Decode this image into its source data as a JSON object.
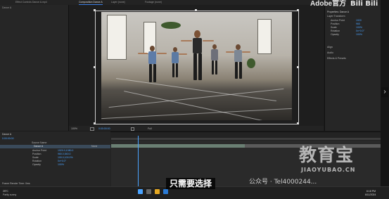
{
  "top_tabs": [
    {
      "label": "Effect Controls Dance A.mp4"
    },
    {
      "label": "Composition Dance A"
    },
    {
      "label": "Layer (none)"
    },
    {
      "label": "Footage (none)"
    }
  ],
  "project_panel": {
    "title": "Dance A"
  },
  "properties_panel": {
    "title": "Properties: Dance A",
    "section": "Layer Transform",
    "rows": [
      {
        "label": "Anchor Point",
        "value": "1920"
      },
      {
        "label": "Position",
        "value": "960"
      },
      {
        "label": "Scale",
        "value": "100%"
      },
      {
        "label": "Rotation",
        "value": "0x+0.0°"
      },
      {
        "label": "Opacity",
        "value": "100%"
      }
    ],
    "groups": [
      "Align",
      "Audio",
      "Effects & Presets"
    ]
  },
  "viewer_controls": {
    "zoom": "100%",
    "timecode": "0:00:00:00",
    "quality": "Full"
  },
  "timeline": {
    "tab_label": "Dance A",
    "timecode": "0:00:00:00",
    "column_header": "Source Name",
    "layer_name": "Dance A",
    "mode": "None",
    "properties": [
      {
        "label": "Anchor Point",
        "value": "1920.0,1080.0"
      },
      {
        "label": "Position",
        "value": "960.0,540.0"
      },
      {
        "label": "Scale",
        "value": "100.0,100.0%"
      },
      {
        "label": "Rotation",
        "value": "0x+0.0°"
      },
      {
        "label": "Opacity",
        "value": "100%"
      }
    ],
    "footer": "Frame Render Time: 0ms"
  },
  "taskbar": {
    "weather": "Partly sunny",
    "temp": "25°C",
    "time": "6:18 PM",
    "date": "6/11/2024"
  },
  "overlays": {
    "subtitle": "只需要选择",
    "watermark_main": "教育宝",
    "watermark_sub": "JIAOYUBAO.CN",
    "wechat": "公众号 · Tel4000244...",
    "brand": "Adobe官方",
    "bili": "Bili Bili"
  }
}
